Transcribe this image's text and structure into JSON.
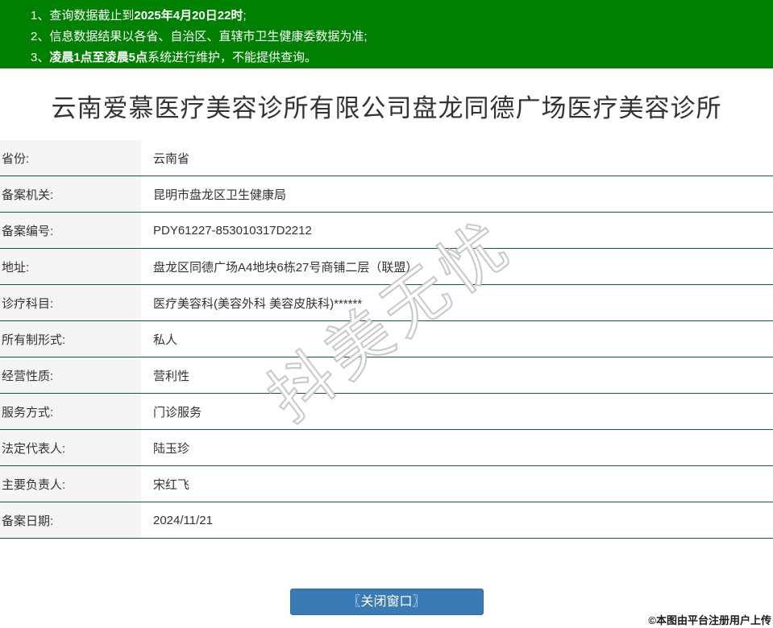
{
  "notice_banner": {
    "bg_color": "#008000",
    "text_color": "#ffffff",
    "lines": [
      {
        "num": "1、",
        "pre": "查询数据截止到",
        "bold": "2025年4月20日22时",
        "post": ";"
      },
      {
        "num": "2、",
        "pre": "信息数据结果以各省、自治区、直辖市卫生健康委数据为准;",
        "bold": "",
        "post": ""
      },
      {
        "num": "3、",
        "pre": "",
        "bold": "凌晨1点至凌晨5点",
        "post": "系统进行维护，不能提供查询。"
      }
    ]
  },
  "title": "云南爱慕医疗美容诊所有限公司盘龙同德广场医疗美容诊所",
  "record_table": {
    "separator_color": "#0a5c32",
    "label_bg": "#f5f5f5",
    "rows": [
      {
        "label": "省份:",
        "value": "云南省"
      },
      {
        "label": "备案机关:",
        "value": "昆明市盘龙区卫生健康局"
      },
      {
        "label": "备案编号:",
        "value": "PDY61227-853010317D2212"
      },
      {
        "label": "地址:",
        "value": "盘龙区同德广场A4地块6栋27号商铺二层（联盟）"
      },
      {
        "label": "诊疗科目:",
        "value": "医疗美容科(美容外科 美容皮肤科)******"
      },
      {
        "label": "所有制形式:",
        "value": "私人"
      },
      {
        "label": "经营性质:",
        "value": "营利性"
      },
      {
        "label": "服务方式:",
        "value": "门诊服务"
      },
      {
        "label": "法定代表人:",
        "value": "陆玉珍"
      },
      {
        "label": "主要负责人:",
        "value": "宋红飞"
      },
      {
        "label": "备案日期:",
        "value": "2024/11/21"
      }
    ]
  },
  "close_button": {
    "label": "〖关闭窗口〗",
    "bg_color": "#3a7ab5"
  },
  "watermarks": {
    "diagonal_text": "抖美无忧",
    "corner_text": "©本图由平台注册用户上传"
  }
}
